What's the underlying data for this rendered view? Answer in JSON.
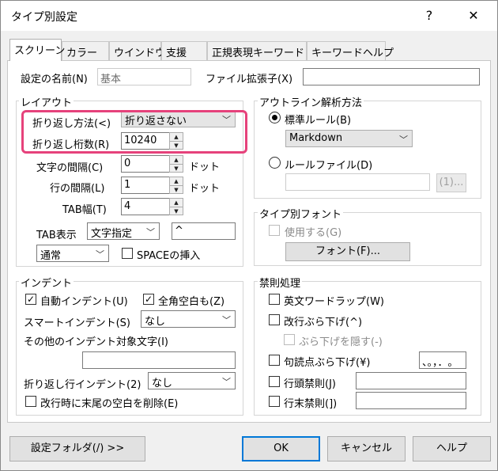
{
  "window": {
    "title": "タイプ別設定",
    "help_glyph": "?",
    "close_glyph": "✕"
  },
  "tabs": [
    {
      "label": "スクリーン"
    },
    {
      "label": "カラー"
    },
    {
      "label": "ウインドウ"
    },
    {
      "label": "支援"
    },
    {
      "label": "正規表現キーワード"
    },
    {
      "label": "キーワードヘルプ"
    }
  ],
  "settings_name": {
    "label": "設定の名前(N)",
    "value": "基本"
  },
  "file_ext": {
    "label": "ファイル拡張子(X)",
    "value": ""
  },
  "layout": {
    "title": "レイアウト",
    "wrap_method": {
      "label": "折り返し方法(<)",
      "value": "折り返さない"
    },
    "wrap_columns": {
      "label": "折り返し桁数(R)",
      "value": "10240"
    },
    "char_spacing": {
      "label": "文字の間隔(C)",
      "value": "0",
      "unit": "ドット"
    },
    "line_spacing": {
      "label": "行の間隔(L)",
      "value": "1",
      "unit": "ドット"
    },
    "tab_width": {
      "label": "TAB幅(T)",
      "value": "4"
    },
    "tab_display": {
      "label": "TAB表示",
      "value": "文字指定",
      "symbol": "^"
    },
    "mode": {
      "value": "通常"
    },
    "space_insert": {
      "label": "SPACEの挿入",
      "checked": false
    }
  },
  "outline": {
    "title": "アウトライン解析方法",
    "standard_rule": {
      "label": "標準ルール(B)",
      "selected": true,
      "value": "Markdown"
    },
    "rule_file": {
      "label": "ルールファイル(D)",
      "selected": false,
      "value": "",
      "button": "(1)..."
    }
  },
  "type_font": {
    "title": "タイプ別フォント",
    "use": {
      "label": "使用する(G)",
      "checked": false
    },
    "font_button": "フォント(F)..."
  },
  "indent": {
    "title": "インデント",
    "auto_indent": {
      "label": "自動インデント(U)",
      "checked": true
    },
    "fullwidth_space": {
      "label": "全角空白も(Z)",
      "checked": true
    },
    "smart_indent": {
      "label": "スマートインデント(S)",
      "value": "なし"
    },
    "other_chars": {
      "label": "その他のインデント対象文字(I)",
      "value": ""
    },
    "wrap_indent": {
      "label": "折り返し行インデント(2)",
      "value": "なし"
    },
    "trim_trailing": {
      "label": "改行時に末尾の空白を削除(E)",
      "checked": false
    }
  },
  "kinsoku": {
    "title": "禁則処理",
    "english_wordwrap": {
      "label": "英文ワードラップ(W)",
      "checked": false
    },
    "newline_burasage": {
      "label": "改行ぶら下げ(^)",
      "checked": false
    },
    "hide_burasage": {
      "label": "ぶら下げを隠す(-)",
      "checked": false
    },
    "kuten_burasage": {
      "label": "句読点ぶら下げ(¥)",
      "checked": false,
      "value": "、。，．｡"
    },
    "line_head": {
      "label": "行頭禁則(J)",
      "checked": false,
      "value": ""
    },
    "line_tail": {
      "label": "行末禁則(])",
      "checked": false,
      "value": ""
    }
  },
  "footer": {
    "settings_folder": "設定フォルダ(/) >>",
    "ok": "OK",
    "cancel": "キャンセル",
    "help": "ヘルプ"
  },
  "colors": {
    "highlight": "#e6427b",
    "accent": "#0078d7"
  }
}
